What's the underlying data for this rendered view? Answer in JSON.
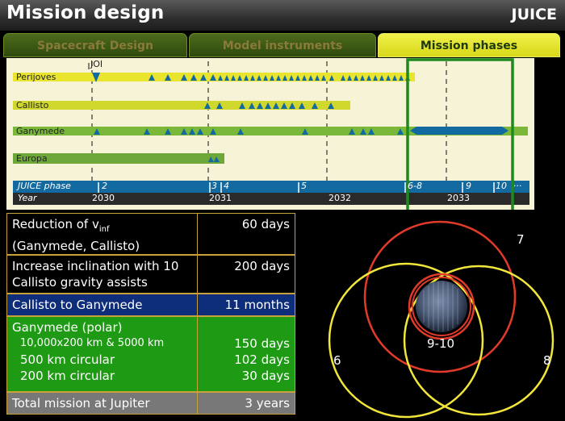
{
  "header": {
    "title": "Mission design",
    "brand": "JUICE"
  },
  "tabs": [
    {
      "label": "Spacecraft Design",
      "active": false
    },
    {
      "label": "Model instruments",
      "active": false
    },
    {
      "label": "Mission phases",
      "active": true
    }
  ],
  "timeline": {
    "joi_label": "JOI",
    "tracks": [
      "Perijoves",
      "Callisto",
      "Ganymede",
      "Europa"
    ],
    "phase_label": "JUICE phase",
    "phase_ticks": [
      "2",
      "3",
      "4",
      "5",
      "6-8",
      "9",
      "10",
      "···"
    ],
    "year_label": "Year",
    "years": [
      "2030",
      "2031",
      "2032",
      "2033"
    ]
  },
  "table": {
    "rows": [
      {
        "left": "Reduction of v",
        "left_sub": "inf",
        "left2": "(Ganymede, Callisto)",
        "right": "60 days"
      },
      {
        "left": "Increase inclination with 10",
        "left2": "Callisto gravity assists",
        "right": "200 days"
      },
      {
        "left": "Callisto to Ganymede",
        "right": "11 months"
      },
      {
        "left": "Ganymede (polar)",
        "items": [
          "10,000x200 km & 5000 km",
          "500 km circular",
          "200 km circular"
        ],
        "values": [
          "150 days",
          "102 days",
          "30 days"
        ]
      },
      {
        "left": "Total mission at Jupiter",
        "right": "3 years"
      }
    ]
  },
  "orbits": {
    "labels": {
      "seven": "7",
      "six": "6",
      "eight": "8",
      "nine_ten": "9-10"
    },
    "colors": {
      "red": "#e23a2a",
      "yellow": "#f2e63a"
    }
  },
  "colors": {
    "accent_yellow": "#e8e23a",
    "track_green": "#7ab83a",
    "phase_blue": "#136aa0",
    "highlight_green": "#1e8a1e"
  }
}
